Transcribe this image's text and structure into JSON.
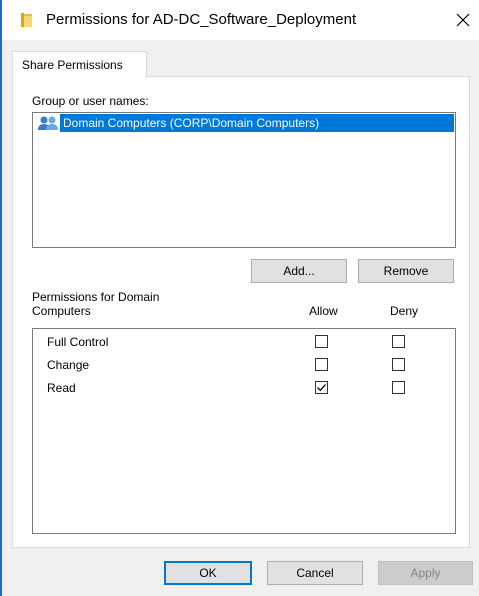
{
  "window": {
    "title": "Permissions for AD-DC_Software_Deployment",
    "icon": "folder-icon",
    "close_icon": "close-icon"
  },
  "tabs": [
    {
      "label": "Share Permissions",
      "selected": true
    }
  ],
  "group_list": {
    "label": "Group or user names:",
    "items": [
      {
        "icon": "user-group-icon",
        "text": "Domain Computers (CORP\\Domain Computers)",
        "selected": true
      }
    ]
  },
  "buttons": {
    "add": "Add...",
    "remove": "Remove",
    "ok": "OK",
    "cancel": "Cancel",
    "apply": "Apply"
  },
  "permissions": {
    "header_line1": "Permissions for Domain",
    "header_line2": "Computers",
    "allow_label": "Allow",
    "deny_label": "Deny",
    "rows": [
      {
        "name": "Full Control",
        "allow": false,
        "deny": false
      },
      {
        "name": "Change",
        "allow": false,
        "deny": false
      },
      {
        "name": "Read",
        "allow": true,
        "deny": false
      }
    ]
  },
  "colors": {
    "accent": "#0078d7",
    "selection": "#0078d7",
    "dialog_bg": "#f0f0f0"
  }
}
